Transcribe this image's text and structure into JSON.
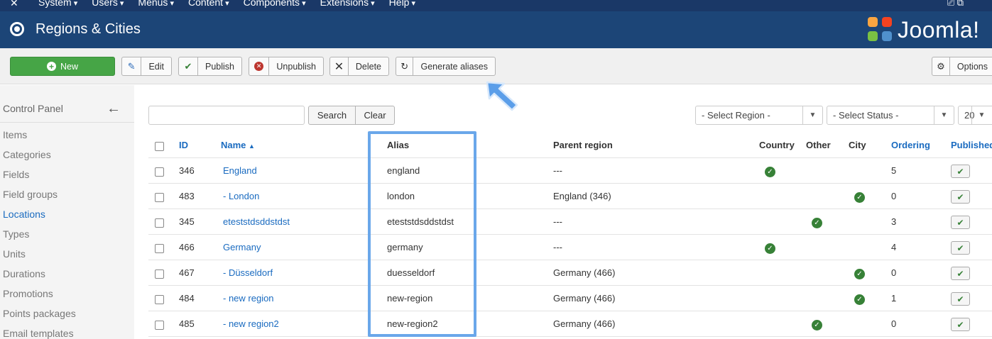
{
  "topnav": {
    "menu": [
      "System",
      "Users",
      "Menus",
      "Content",
      "Components",
      "Extensions",
      "Help"
    ],
    "right_glyph": "⎚ ⧉"
  },
  "header": {
    "title": "Regions & Cities",
    "brand": "Joomla!"
  },
  "toolbar": {
    "new": "New",
    "edit": "Edit",
    "publish": "Publish",
    "unpublish": "Unpublish",
    "delete": "Delete",
    "generate_aliases": "Generate aliases",
    "options": "Options"
  },
  "sidebar": {
    "control_panel": "Control Panel",
    "items": [
      "Items",
      "Categories",
      "Fields",
      "Field groups",
      "Locations",
      "Types",
      "Units",
      "Durations",
      "Promotions",
      "Points packages",
      "Email templates"
    ],
    "active": "Locations"
  },
  "filters": {
    "search_value": "",
    "search_btn": "Search",
    "clear_btn": "Clear",
    "region_select": "- Select Region -",
    "status_select": "- Select Status -",
    "limit": "20"
  },
  "table": {
    "headers": {
      "id": "ID",
      "name": "Name",
      "alias": "Alias",
      "parent": "Parent region",
      "country": "Country",
      "other": "Other",
      "city": "City",
      "ordering": "Ordering",
      "published": "Published"
    },
    "rows": [
      {
        "id": "346",
        "name": "England",
        "alias": "england",
        "parent": "---",
        "type": "country",
        "ordering": "5"
      },
      {
        "id": "483",
        "name": " - London",
        "alias": "london",
        "parent": "England (346)",
        "type": "city",
        "ordering": "0"
      },
      {
        "id": "345",
        "name": "eteststdsddstdst",
        "alias": "eteststdsddstdst",
        "parent": "---",
        "type": "other",
        "ordering": "3"
      },
      {
        "id": "466",
        "name": "Germany",
        "alias": "germany",
        "parent": "---",
        "type": "country",
        "ordering": "4"
      },
      {
        "id": "467",
        "name": " - Düsseldorf",
        "alias": "duesseldorf",
        "parent": "Germany (466)",
        "type": "city",
        "ordering": "0"
      },
      {
        "id": "484",
        "name": " - new region",
        "alias": "new-region",
        "parent": "Germany (466)",
        "type": "city",
        "ordering": "1"
      },
      {
        "id": "485",
        "name": " - new region2",
        "alias": "new-region2",
        "parent": "Germany (466)",
        "type": "other",
        "ordering": "0"
      }
    ]
  },
  "colors": {
    "navbar": "#1a3867",
    "header": "#1c4577",
    "new_button": "#46a546",
    "link": "#1a6bc0",
    "check": "#378137",
    "highlight": "#6aa7ea"
  }
}
